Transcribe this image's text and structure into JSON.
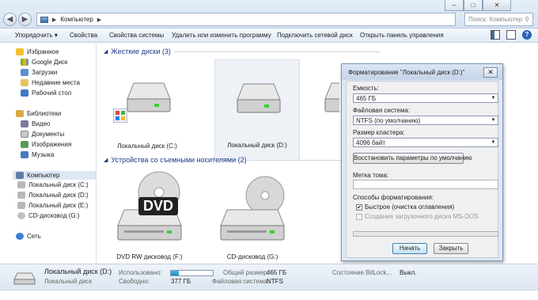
{
  "window": {
    "title_controls": {
      "minimize": "–",
      "maximize": "□",
      "close": "✕"
    }
  },
  "address_bar": {
    "path": "Компьютер",
    "search_placeholder": "Поиск: Компьютер"
  },
  "toolbar": {
    "organize": "Упорядочить ▾",
    "properties": "Свойства",
    "system_properties": "Свойства системы",
    "uninstall": "Удалить или изменить программу",
    "map_drive": "Подключить сетевой диск",
    "control_panel": "Открыть панель управления"
  },
  "sidebar": {
    "favorites": "Избранное",
    "google_drive": "Google Диск",
    "downloads": "Загрузки",
    "recent": "Недавние места",
    "desktop": "Рабочий стол",
    "libraries": "Библиотеки",
    "video": "Видео",
    "documents": "Документы",
    "images": "Изображения",
    "music": "Музыка",
    "computer": "Компьютер",
    "disk_c": "Локальный диск (C:)",
    "disk_d": "Локальный диск (D:)",
    "disk_e": "Локальный диск (E:)",
    "cd_g": "CD-дисковод (G:)",
    "network": "Сеть"
  },
  "main": {
    "hard_disks_header": "Жесткие диски (3)",
    "removable_header": "Устройства со съемными носителями (2)",
    "drive_c": "Локальный диск (C:)",
    "drive_d": "Локальный диск (D:)",
    "drive_f": "DVD RW дисковод (F:)",
    "drive_f_badge": "DVD",
    "drive_g": "CD-дисковод (G:)"
  },
  "dialog": {
    "title": "Форматирование \"Локальный диск (D:)\"",
    "capacity_label": "Емкость:",
    "capacity_value": "465 ГБ",
    "filesystem_label": "Файловая система:",
    "filesystem_value": "NTFS (по умолчанию)",
    "cluster_label": "Размер кластера:",
    "cluster_value": "4096 байт",
    "restore_button": "Восстановить параметры по умолчанию",
    "volume_label": "Метка тома:",
    "volume_value": "",
    "format_options_label": "Способы форматирования:",
    "quick_format": "Быстрое (очистка оглавления)",
    "quick_format_checked": true,
    "msdos_disk": "Создание загрузочного диска MS-DOS",
    "start_button": "Начать",
    "close_button": "Закрыть"
  },
  "status": {
    "drive_name": "Локальный диск (D:)",
    "drive_type": "Локальный диск",
    "used_label": "Использовано:",
    "used_fraction": 0.19,
    "free_label": "Свободно:",
    "free_value": "377 ГБ",
    "total_label": "Общий размер:",
    "total_value": "465 ГБ",
    "fs_label": "Файловая система:",
    "fs_value": "NTFS",
    "bitlocker_label": "Состояние BitLock...",
    "bitlocker_value": "Выкл."
  },
  "colors": {
    "accent": "#1e3a8a",
    "selection": "#dde8f5",
    "used_bar": "#1a8cc9"
  }
}
